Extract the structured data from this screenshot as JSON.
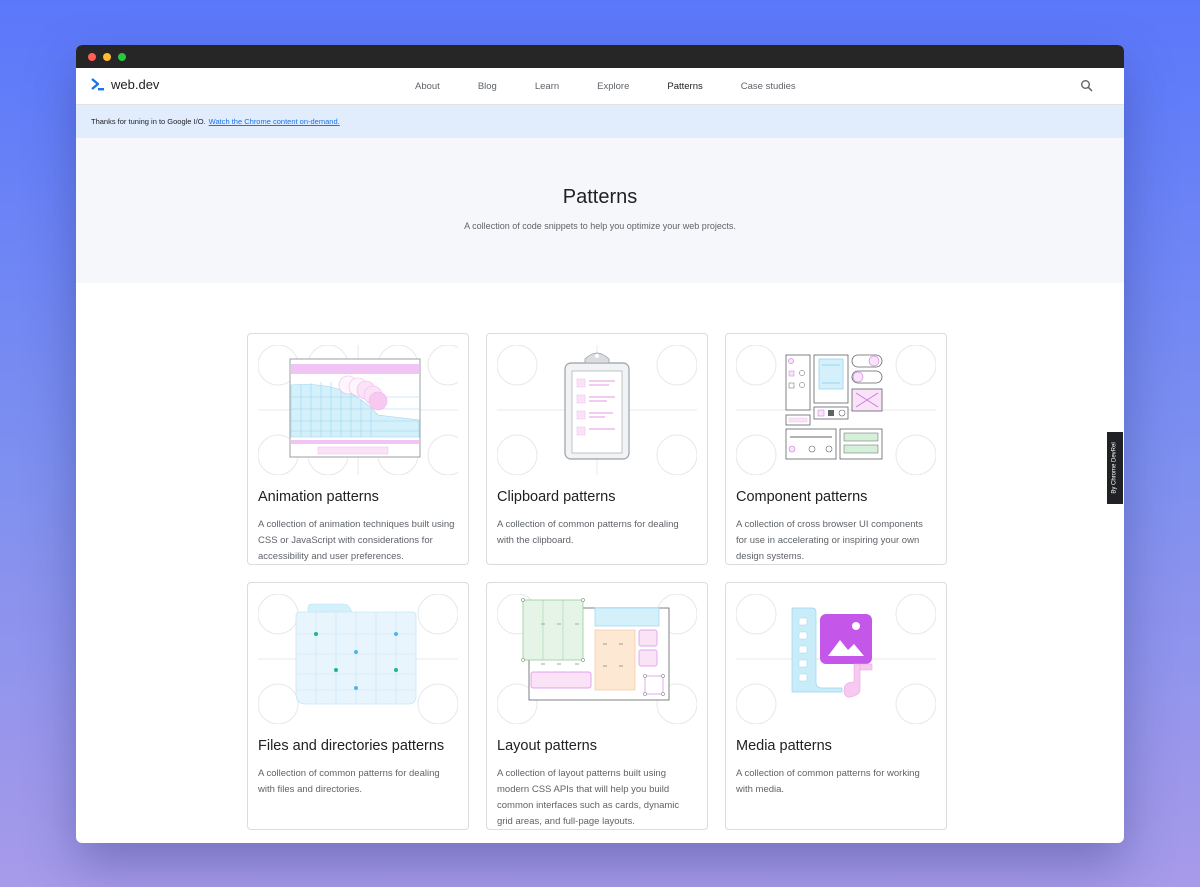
{
  "nav": {
    "logo_text": "web.dev",
    "links": [
      {
        "label": "About"
      },
      {
        "label": "Blog"
      },
      {
        "label": "Learn"
      },
      {
        "label": "Explore"
      },
      {
        "label": "Patterns"
      },
      {
        "label": "Case studies"
      }
    ],
    "active": "Patterns"
  },
  "banner": {
    "text": "Thanks for tuning in to Google I/O.",
    "link": "Watch the Chrome content on-demand."
  },
  "hero": {
    "title": "Patterns",
    "subtitle": "A collection of code snippets to help you optimize your web projects."
  },
  "cards": [
    {
      "title": "Animation patterns",
      "description": "A collection of animation techniques built using CSS or JavaScript with considerations for accessibility and user preferences."
    },
    {
      "title": "Clipboard patterns",
      "description": "A collection of common patterns for dealing with the clipboard."
    },
    {
      "title": "Component patterns",
      "description": "A collection of cross browser UI components for use in accelerating or inspiring your own design systems."
    },
    {
      "title": "Files and directories patterns",
      "description": "A collection of common patterns for dealing with files and directories."
    },
    {
      "title": "Layout patterns",
      "description": "A collection of layout patterns built using modern CSS APIs that will help you build common interfaces such as cards, dynamic grid areas, and full-page layouts."
    },
    {
      "title": "Media patterns",
      "description": "A collection of common patterns for working with media."
    }
  ],
  "devrel_badge": "By Chrome DevRel",
  "colors": {
    "accent": "#1a73e8",
    "banner_bg": "#e1edfd",
    "hero_bg": "#f6f7fa"
  }
}
